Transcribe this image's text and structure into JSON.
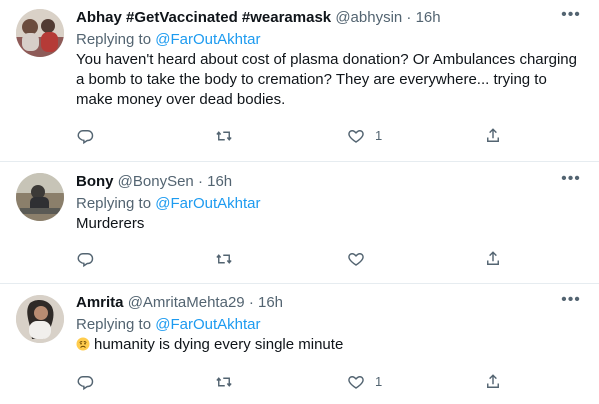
{
  "tweets": [
    {
      "name": "Abhay #GetVaccinated #wearamask",
      "handle": "@abhysin",
      "dot": "·",
      "time": "16h",
      "replying_prefix": "Replying to ",
      "replying_to": "@FarOutAkhtar",
      "text": "You haven't heard about cost of plasma donation? Or Ambulances charging a bomb to take the body to cremation? They are everywhere... trying to make money over dead bodies.",
      "likes": "1",
      "more": "•••"
    },
    {
      "name": "Bony",
      "handle": "@BonySen",
      "dot": "·",
      "time": "16h",
      "replying_prefix": "Replying to ",
      "replying_to": "@FarOutAkhtar",
      "text": "Murderers",
      "likes": "",
      "more": "•••"
    },
    {
      "name": "Amrita",
      "handle": "@AmritaMehta29",
      "dot": "·",
      "time": "16h",
      "replying_prefix": "Replying to ",
      "replying_to": "@FarOutAkhtar",
      "text": "humanity is dying every single minute",
      "likes": "1",
      "more": "•••"
    }
  ],
  "icons": {
    "reply": "reply-icon",
    "retweet": "retweet-icon",
    "like": "like-icon",
    "share": "share-icon",
    "emoji": "disappointed-face-emoji"
  },
  "colors": {
    "text": "#0f1419",
    "secondary": "#536471",
    "link": "#1d9bf0",
    "divider": "#e6ecf0"
  }
}
